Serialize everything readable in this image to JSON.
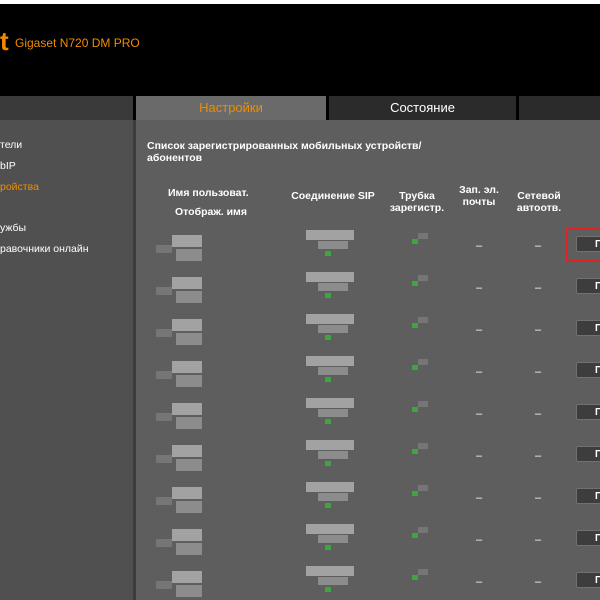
{
  "header": {
    "logo_fragment": "t",
    "product": "Gigaset N720 DM PRO"
  },
  "nav": {
    "tabs": [
      {
        "label": ""
      },
      {
        "label": "Настройки",
        "active": true
      },
      {
        "label": "Состояние"
      },
      {
        "label": ""
      }
    ]
  },
  "sidebar": {
    "items": [
      {
        "label": "тели"
      },
      {
        "label": "bIP"
      },
      {
        "label": "ройства",
        "active": true
      },
      {
        "label": "ужбы"
      },
      {
        "label": "равочники онлайн"
      }
    ]
  },
  "main": {
    "section_title": "Список зарегистрированных мобильных устройств/ абонентов",
    "columns": {
      "user_line1": "Имя пользоват.",
      "user_line2": "Отображ. имя",
      "sip": "Соединение SIP",
      "handset": "Трубка зарегистр.",
      "voicemail": "Зап. эл. почты",
      "autoattendant": "Сетевой автоотв."
    },
    "rows": [
      {
        "voicemail": "–",
        "autoattendant": "–",
        "button": "П"
      },
      {
        "voicemail": "–",
        "autoattendant": "–",
        "button": "П"
      },
      {
        "voicemail": "–",
        "autoattendant": "–",
        "button": "П"
      },
      {
        "voicemail": "–",
        "autoattendant": "–",
        "button": "П"
      },
      {
        "voicemail": "–",
        "autoattendant": "–",
        "button": "П"
      },
      {
        "voicemail": "–",
        "autoattendant": "–",
        "button": "П"
      },
      {
        "voicemail": "–",
        "autoattendant": "–",
        "button": "П"
      },
      {
        "voicemail": "–",
        "autoattendant": "–",
        "button": "П"
      },
      {
        "voicemail": "–",
        "autoattendant": "–",
        "button": "П"
      }
    ]
  },
  "colors": {
    "accent": "#f08c00",
    "status_green": "#3fa53f",
    "highlight_red": "#e32323"
  }
}
